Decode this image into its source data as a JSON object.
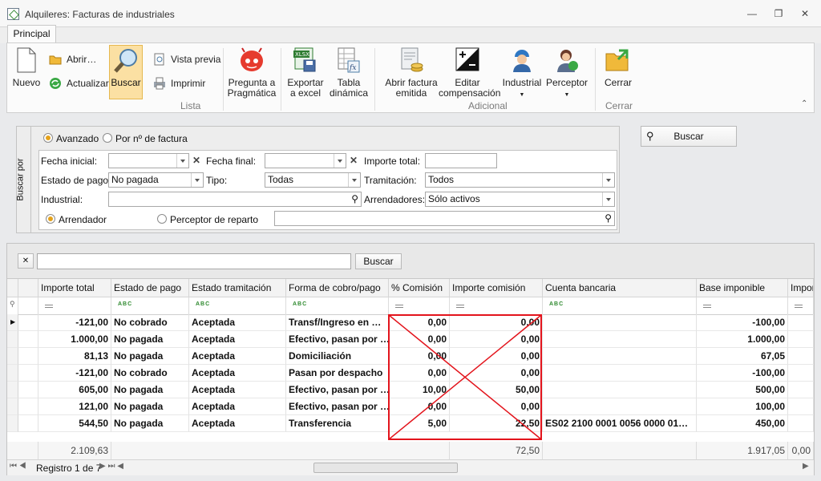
{
  "window": {
    "title": "Alquileres: Facturas de industriales",
    "minimize": "—",
    "restore": "❐",
    "close": "✕"
  },
  "tabs": [
    {
      "label": "Principal"
    }
  ],
  "ribbon": {
    "nuevo": "Nuevo",
    "abrir": "Abrir…",
    "actualizar": "Actualizar",
    "buscar": "Buscar",
    "vista_previa": "Vista previa",
    "imprimir": "Imprimir",
    "pregunta_1": "Pregunta a",
    "pregunta_2": "Pragmática",
    "exportar_1": "Exportar",
    "exportar_2": "a excel",
    "tabla_1": "Tabla",
    "tabla_2": "dinámica",
    "abrir_fact_1": "Abrir factura",
    "abrir_fact_2": "emitida",
    "editar_1": "Editar",
    "editar_2": "compensación",
    "industrial": "Industrial",
    "perceptor": "Perceptor",
    "cerrar": "Cerrar",
    "group_lista": "Lista",
    "group_adicional": "Adicional",
    "group_cerrar": "Cerrar",
    "xlsx_badge": "XLSX",
    "fx_badge": "fx"
  },
  "search": {
    "side_label": "Buscar por",
    "mode_avanzado": "Avanzado",
    "mode_factura": "Por nº de factura",
    "fecha_inicial_label": "Fecha inicial:",
    "fecha_inicial": "",
    "fecha_final_label": "Fecha final:",
    "fecha_final": "",
    "importe_total_label": "Importe total:",
    "importe_total": "",
    "estado_pago_label": "Estado de pago:",
    "estado_pago": "No pagada",
    "tipo_label": "Tipo:",
    "tipo": "Todas",
    "tramitacion_label": "Tramitación:",
    "tramitacion": "Todos",
    "industrial_label": "Industrial:",
    "industrial": "",
    "arrendadores_label": "Arrendadores:",
    "arrendadores": "Sólo activos",
    "arrendador_radio": "Arrendador",
    "perceptor_radio": "Perceptor de reparto",
    "perceptor_value": "",
    "button": "Buscar"
  },
  "grid": {
    "find_text": "",
    "find_button": "Buscar",
    "columns": [
      "Importe total",
      "Estado de pago",
      "Estado tramitación",
      "Forma de cobro/pago",
      "% Comisión",
      "Importe comisión",
      "Cuenta bancaria",
      "Base imponible",
      "Impor"
    ],
    "rows": [
      [
        "-121,00",
        "No cobrado",
        "Aceptada",
        "Transf/Ingreso en …",
        "0,00",
        "0,00",
        "",
        "-100,00"
      ],
      [
        "1.000,00",
        "No pagada",
        "Aceptada",
        "Efectivo, pasan por …",
        "0,00",
        "0,00",
        "",
        "1.000,00"
      ],
      [
        "81,13",
        "No pagada",
        "Aceptada",
        "Domiciliación",
        "0,00",
        "0,00",
        "",
        "67,05"
      ],
      [
        "-121,00",
        "No cobrado",
        "Aceptada",
        "Pasan por despacho",
        "0,00",
        "0,00",
        "",
        "-100,00"
      ],
      [
        "605,00",
        "No pagada",
        "Aceptada",
        "Efectivo, pasan por …",
        "10,00",
        "50,00",
        "",
        "500,00"
      ],
      [
        "121,00",
        "No pagada",
        "Aceptada",
        "Efectivo, pasan por …",
        "0,00",
        "0,00",
        "",
        "100,00"
      ],
      [
        "544,50",
        "No pagada",
        "Aceptada",
        "Transferencia",
        "5,00",
        "22,50",
        "ES02 2100 0001 0056 0000 01…",
        "450,00"
      ]
    ],
    "totals": {
      "importe_total": "2.109,63",
      "importe_comision": "72,50",
      "base_imponible": "1.917,05",
      "extra": "0,00"
    },
    "record_label": "Registro 1 de 7"
  },
  "colors": {
    "accent": "#e5a21b",
    "annotation": "#e3141c",
    "selected_button": "#fbe0a3"
  }
}
